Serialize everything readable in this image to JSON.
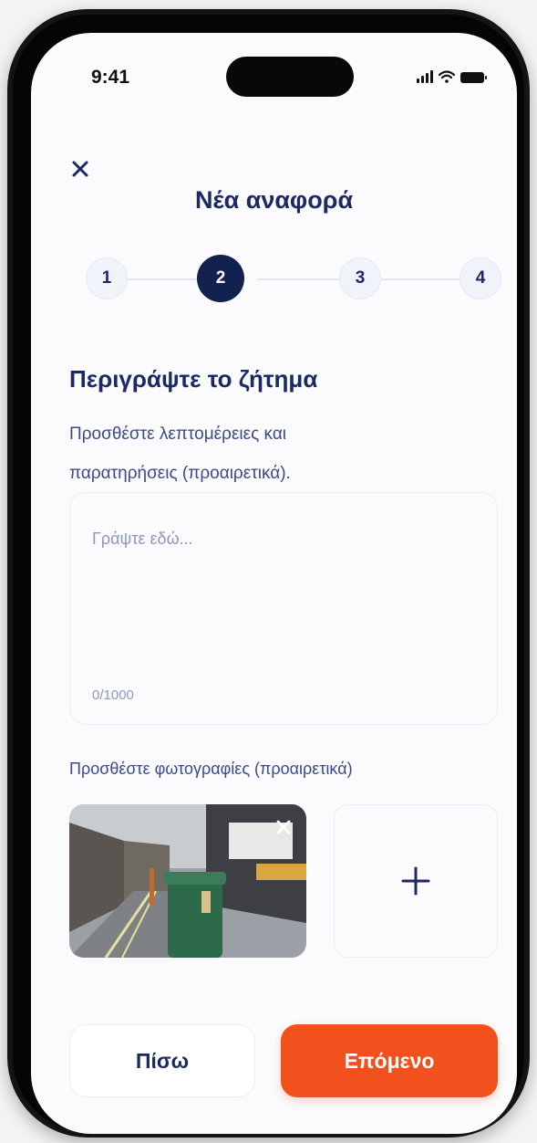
{
  "status_bar": {
    "time": "9:41"
  },
  "header": {
    "title": "Νέα αναφορά",
    "close_icon": "close-icon"
  },
  "stepper": {
    "steps": [
      {
        "label": "1",
        "active": false
      },
      {
        "label": "2",
        "active": true
      },
      {
        "label": "3",
        "active": false
      },
      {
        "label": "4",
        "active": false
      }
    ]
  },
  "section": {
    "title": "Περιγράψτε το ζήτημα",
    "subtitle_line1": "Προσθέστε λεπτομέρειες και",
    "subtitle_line2": "παρατηρήσεις (προαιρετικά)."
  },
  "description": {
    "placeholder": "Γράψτε εδώ...",
    "counter": "0/1000"
  },
  "photos": {
    "label": "Προσθέστε φωτογραφίες (προαιρετικά)",
    "add_icon": "plus-icon",
    "remove_icon": "close-icon"
  },
  "footer": {
    "back_label": "Πίσω",
    "next_label": "Επόμενο"
  },
  "colors": {
    "primary": "#1b2a63",
    "accent": "#f2501d",
    "active_step": "#13214f"
  }
}
